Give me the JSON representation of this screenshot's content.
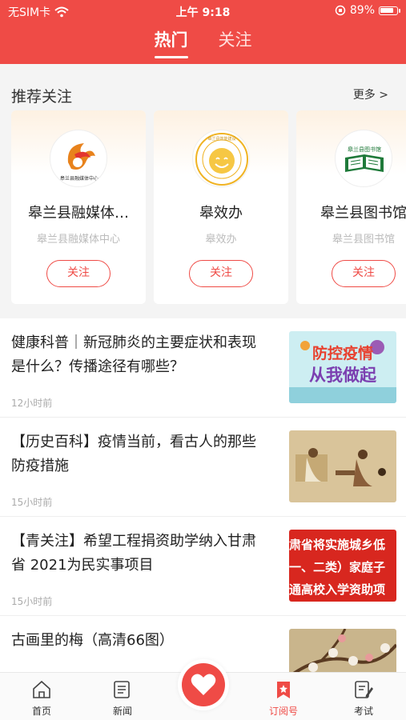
{
  "status": {
    "carrier": "无SIM卡",
    "time": "上午 9:18",
    "battery": "89%",
    "battery_level": 0.89
  },
  "tabs": [
    {
      "label": "热门"
    },
    {
      "label": "关注"
    }
  ],
  "recommend": {
    "title": "推荐关注",
    "more": "更多 >",
    "cards": [
      {
        "name": "皋兰县融媒体…",
        "sub": "皋兰县融媒体中心",
        "follow": "关注",
        "logo_text": "皋兰县融媒体中心"
      },
      {
        "name": "皋效办",
        "sub": "皋效办",
        "follow": "关注",
        "logo_text": "皋兰县效能建设"
      },
      {
        "name": "皋兰县图书馆",
        "sub": "皋兰县图书馆",
        "follow": "关注",
        "logo_text": "皋兰县图书馆"
      }
    ]
  },
  "news": [
    {
      "title": "健康科普｜新冠肺炎的主要症状和表现是什么？传播途径有哪些？",
      "time": "12小时前",
      "thumb_line1": "防控疫情",
      "thumb_line2": "从我做起"
    },
    {
      "title": "【历史百科】疫情当前，看古人的那些防疫措施",
      "time": "15小时前"
    },
    {
      "title": "【青关注】希望工程捐资助学纳入甘肃省 2021为民实事项目",
      "time": "15小时前",
      "thumb_lines": [
        "肃省将实施城乡低",
        "一、二类）家庭子",
        "通高校入学资助项"
      ]
    },
    {
      "title": "古画里的梅（高清66图）",
      "time": ""
    }
  ],
  "bottom_nav": [
    {
      "label": "首页",
      "icon": "home-icon"
    },
    {
      "label": "新闻",
      "icon": "news-icon"
    },
    {
      "label": "订阅号",
      "icon": "bookmark-star-icon"
    },
    {
      "label": "考试",
      "icon": "exam-icon"
    }
  ],
  "colors": {
    "brand": "#ef4b46",
    "bg": "#f4f4f4"
  }
}
